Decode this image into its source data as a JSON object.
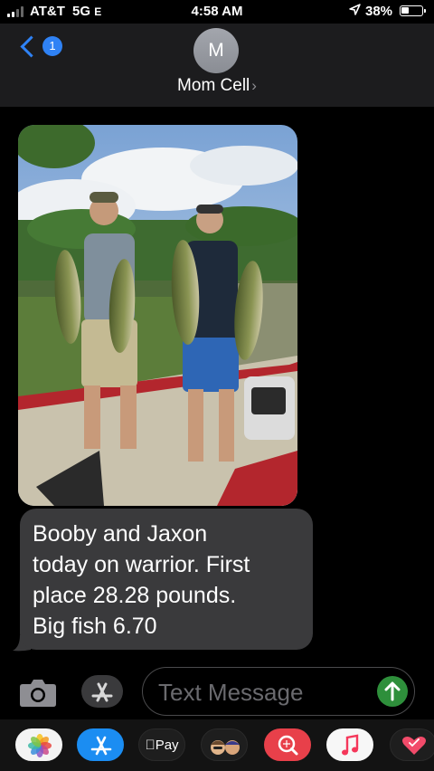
{
  "status_bar": {
    "carrier": "AT&T",
    "network": "5G",
    "network_suffix": "E",
    "time": "4:58 AM",
    "battery": "38%",
    "battery_level": 0.38
  },
  "header": {
    "back_badge": "1",
    "avatar_initial": "M",
    "contact_name": "Mom Cell",
    "contact_chevron": "›"
  },
  "messages": [
    {
      "type": "photo",
      "icon": "fishing-photo"
    },
    {
      "type": "text",
      "lines": [
        "Booby and Jaxon",
        "today on warrior. First",
        "place 28.28 pounds.",
        "Big fish 6.70"
      ]
    }
  ],
  "compose": {
    "placeholder": "Text Message"
  },
  "app_tray": {
    "items": [
      "photos",
      "app-store",
      "apple-pay",
      "memoji",
      "search-images",
      "music",
      "digital-touch"
    ],
    "apple_pay_label": "Pay"
  },
  "colors": {
    "accent_blue": "#2f82f5",
    "send_green": "#2e8f3b",
    "bubble_gray": "#3a3a3c",
    "header_bg": "#1c1c1e"
  }
}
